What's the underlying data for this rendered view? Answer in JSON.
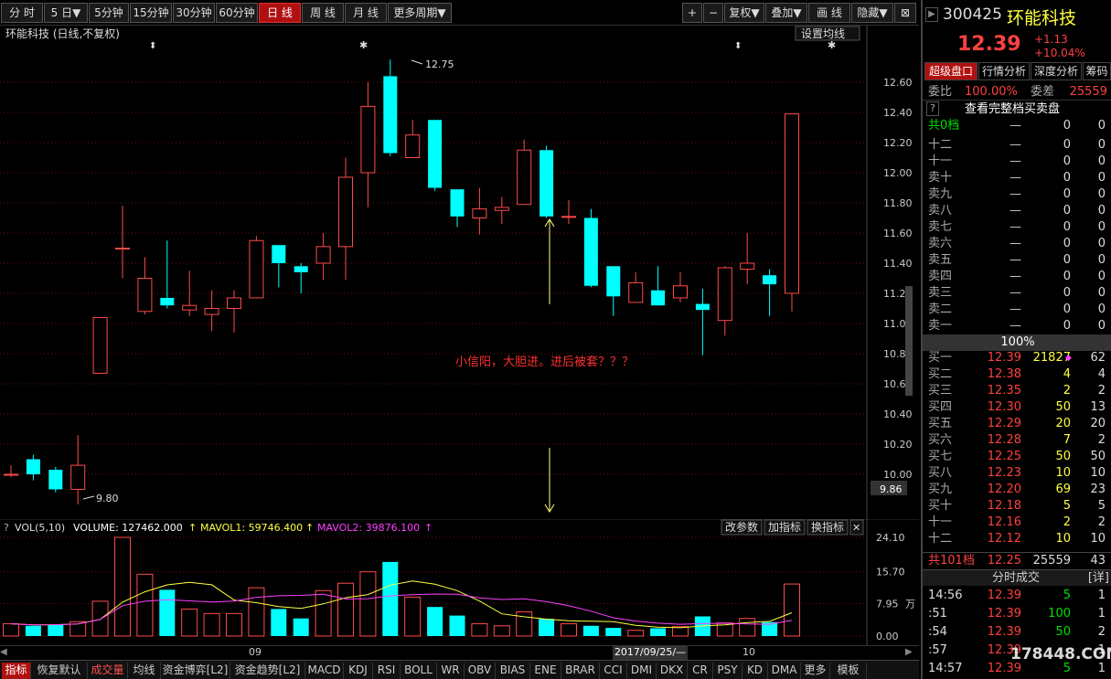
{
  "toolbar": {
    "periods": [
      "分 时",
      "5 日▼",
      "5分钟",
      "15分钟",
      "30分钟",
      "60分钟",
      "日 线",
      "周 线",
      "月 线",
      "更多周期▼"
    ],
    "active_period": "日 线",
    "right_buttons": [
      "+",
      "−",
      "复权▼",
      "叠加▼",
      "画 线",
      "隐藏▼"
    ],
    "close_icon_label": "⊠"
  },
  "chart": {
    "title": "环能科技 (日线,不复权)",
    "ma_settings": "设置均线",
    "annotation_text": "小信阳，大胆进。进后被套？？？",
    "high_label": "12.75",
    "low_label": "9.80",
    "cursor_price": "9.86",
    "y_labels": [
      "12.60",
      "12.40",
      "12.20",
      "12.00",
      "11.80",
      "11.60",
      "11.40",
      "11.20",
      "11.00",
      "10.80",
      "10.60",
      "10.40",
      "10.20",
      "10.00"
    ]
  },
  "volume": {
    "label": "VOL(5,10)",
    "volume_text": "VOLUME: 127462.000",
    "mavol1_text": "MAVOL1: 59746.400",
    "mavol2_text": "MAVOL2: 39876.100",
    "buttons": [
      "改参数",
      "加指标",
      "换指标",
      "✕"
    ],
    "y_labels": [
      "24.10",
      "15.70",
      "7.95",
      "0.00"
    ],
    "unit": "万"
  },
  "axis": {
    "month_09": "09",
    "month_10": "10",
    "cursor_date": "2017/09/25/—"
  },
  "bottom_tabs": [
    "指标",
    "恢复默认",
    "成交量",
    "均线",
    "资金博弈[L2]",
    "资金趋势[L2]",
    "MACD",
    "KDJ",
    "RSI",
    "BOLL",
    "WR",
    "OBV",
    "BIAS",
    "ENE",
    "BRAR",
    "CCI",
    "DMI",
    "DKX",
    "CR",
    "PSY",
    "KD",
    "DMA",
    "更多",
    "模板"
  ],
  "active_bottom_tab": "成交量",
  "stock": {
    "code": "300425",
    "name": "环能科技",
    "price": "12.39",
    "change": "+1.13",
    "change_pct": "+10.04%"
  },
  "right_tabs": [
    "超级盘口",
    "行情分析",
    "深度分析",
    "筹码"
  ],
  "weibi": {
    "label1": "委比",
    "value1": "100.00%",
    "label2": "委差",
    "value2": "25559"
  },
  "full_book_link": "查看完整档买卖盘",
  "sell_total": "共0档",
  "sell_rows": [
    {
      "label": "十二",
      "price": "—",
      "vol": "0",
      "cnt": "0"
    },
    {
      "label": "十一",
      "price": "—",
      "vol": "0",
      "cnt": "0"
    },
    {
      "label": "卖十",
      "price": "—",
      "vol": "0",
      "cnt": "0"
    },
    {
      "label": "卖九",
      "price": "—",
      "vol": "0",
      "cnt": "0"
    },
    {
      "label": "卖八",
      "price": "—",
      "vol": "0",
      "cnt": "0"
    },
    {
      "label": "卖七",
      "price": "—",
      "vol": "0",
      "cnt": "0"
    },
    {
      "label": "卖六",
      "price": "—",
      "vol": "0",
      "cnt": "0"
    },
    {
      "label": "卖五",
      "price": "—",
      "vol": "0",
      "cnt": "0"
    },
    {
      "label": "卖四",
      "price": "—",
      "vol": "0",
      "cnt": "0"
    },
    {
      "label": "卖三",
      "price": "—",
      "vol": "0",
      "cnt": "0"
    },
    {
      "label": "卖二",
      "price": "—",
      "vol": "0",
      "cnt": "0"
    },
    {
      "label": "卖一",
      "price": "—",
      "vol": "0",
      "cnt": "0"
    }
  ],
  "mid_pct": "100%",
  "buy_rows": [
    {
      "label": "买一",
      "price": "12.39",
      "vol": "21827",
      "cnt": "62"
    },
    {
      "label": "买二",
      "price": "12.38",
      "vol": "4",
      "cnt": "4"
    },
    {
      "label": "买三",
      "price": "12.35",
      "vol": "2",
      "cnt": "2"
    },
    {
      "label": "买四",
      "price": "12.30",
      "vol": "50",
      "cnt": "13"
    },
    {
      "label": "买五",
      "price": "12.29",
      "vol": "20",
      "cnt": "20"
    },
    {
      "label": "买六",
      "price": "12.28",
      "vol": "7",
      "cnt": "2"
    },
    {
      "label": "买七",
      "price": "12.25",
      "vol": "50",
      "cnt": "50"
    },
    {
      "label": "买八",
      "price": "12.23",
      "vol": "10",
      "cnt": "10"
    },
    {
      "label": "买九",
      "price": "12.20",
      "vol": "69",
      "cnt": "23"
    },
    {
      "label": "买十",
      "price": "12.18",
      "vol": "5",
      "cnt": "5"
    },
    {
      "label": "十一",
      "price": "12.16",
      "vol": "2",
      "cnt": "2"
    },
    {
      "label": "十二",
      "price": "12.12",
      "vol": "10",
      "cnt": "10"
    }
  ],
  "buy_total": {
    "label": "共101档",
    "price": "12.25",
    "vol": "25559",
    "cnt": "43"
  },
  "trades_header": "分时成交",
  "trades_detail": "[详]",
  "trades": [
    {
      "time": "14:56",
      "price": "12.39",
      "vol": "5",
      "cnt": "1"
    },
    {
      "time": ":51",
      "price": "12.39",
      "vol": "100",
      "cnt": "1"
    },
    {
      "time": ":54",
      "price": "12.39",
      "vol": "50",
      "cnt": "2"
    },
    {
      "time": ":57",
      "price": "12.39",
      "vol": "",
      "cnt": "1"
    },
    {
      "time": "14:57",
      "price": "12.39",
      "vol": "5",
      "cnt": "1"
    }
  ],
  "watermark": "178448.COM",
  "chart_data": {
    "type": "candlestick",
    "title": "环能科技 (日线,不复权)",
    "ylim": [
      9.8,
      12.75
    ],
    "candles": [
      {
        "o": 10.0,
        "h": 10.06,
        "l": 9.98,
        "c": 10.0
      },
      {
        "o": 10.1,
        "h": 10.13,
        "l": 9.96,
        "c": 10.0
      },
      {
        "o": 10.03,
        "h": 10.05,
        "l": 9.88,
        "c": 9.9
      },
      {
        "o": 9.9,
        "h": 10.26,
        "l": 9.8,
        "c": 10.06
      },
      {
        "o": 10.67,
        "h": 11.04,
        "l": 10.67,
        "c": 11.04
      },
      {
        "o": 11.5,
        "h": 11.78,
        "l": 11.3,
        "c": 11.5
      },
      {
        "o": 11.08,
        "h": 11.44,
        "l": 11.06,
        "c": 11.3
      },
      {
        "o": 11.17,
        "h": 11.55,
        "l": 11.1,
        "c": 11.12
      },
      {
        "o": 11.09,
        "h": 11.35,
        "l": 11.05,
        "c": 11.12
      },
      {
        "o": 11.06,
        "h": 11.22,
        "l": 10.95,
        "c": 11.1
      },
      {
        "o": 11.1,
        "h": 11.22,
        "l": 10.94,
        "c": 11.17
      },
      {
        "o": 11.17,
        "h": 11.58,
        "l": 11.17,
        "c": 11.55
      },
      {
        "o": 11.52,
        "h": 11.52,
        "l": 11.24,
        "c": 11.4
      },
      {
        "o": 11.38,
        "h": 11.4,
        "l": 11.2,
        "c": 11.34
      },
      {
        "o": 11.4,
        "h": 11.6,
        "l": 11.29,
        "c": 11.51
      },
      {
        "o": 11.51,
        "h": 12.1,
        "l": 11.29,
        "c": 11.97
      },
      {
        "o": 12.0,
        "h": 12.6,
        "l": 11.77,
        "c": 12.44
      },
      {
        "o": 12.64,
        "h": 12.75,
        "l": 12.11,
        "c": 12.13
      },
      {
        "o": 12.1,
        "h": 12.35,
        "l": 12.1,
        "c": 12.25
      },
      {
        "o": 12.35,
        "h": 12.35,
        "l": 11.88,
        "c": 11.9
      },
      {
        "o": 11.89,
        "h": 11.89,
        "l": 11.64,
        "c": 11.71
      },
      {
        "o": 11.7,
        "h": 11.9,
        "l": 11.59,
        "c": 11.76
      },
      {
        "o": 11.75,
        "h": 11.84,
        "l": 11.66,
        "c": 11.77
      },
      {
        "o": 11.79,
        "h": 12.22,
        "l": 11.79,
        "c": 12.15
      },
      {
        "o": 12.15,
        "h": 12.18,
        "l": 11.7,
        "c": 11.71
      },
      {
        "o": 11.71,
        "h": 11.82,
        "l": 11.66,
        "c": 11.71
      },
      {
        "o": 11.7,
        "h": 11.76,
        "l": 11.24,
        "c": 11.25
      },
      {
        "o": 11.38,
        "h": 11.38,
        "l": 11.05,
        "c": 11.18
      },
      {
        "o": 11.14,
        "h": 11.34,
        "l": 11.14,
        "c": 11.27
      },
      {
        "o": 11.22,
        "h": 11.38,
        "l": 11.12,
        "c": 11.12
      },
      {
        "o": 11.17,
        "h": 11.34,
        "l": 11.14,
        "c": 11.25
      },
      {
        "o": 11.13,
        "h": 11.23,
        "l": 10.79,
        "c": 11.09
      },
      {
        "o": 11.02,
        "h": 11.38,
        "l": 10.92,
        "c": 11.37
      },
      {
        "o": 11.36,
        "h": 11.6,
        "l": 11.26,
        "c": 11.4
      },
      {
        "o": 11.32,
        "h": 11.36,
        "l": 11.05,
        "c": 11.26
      },
      {
        "o": 11.2,
        "h": 11.25,
        "l": 11.08,
        "c": 12.39
      }
    ],
    "volume": [
      3.0,
      2.5,
      2.8,
      3.5,
      8.5,
      24.1,
      15.1,
      11.3,
      6.6,
      5.5,
      5.5,
      11.8,
      6.6,
      4.3,
      11.1,
      12.9,
      15.7,
      18.1,
      9.5,
      7.1,
      5.0,
      3.0,
      2.5,
      5.9,
      4.2,
      3.0,
      2.5,
      2.0,
      1.4,
      1.9,
      2.3,
      4.8,
      3.2,
      4.3,
      3.4,
      12.7
    ],
    "vol_ylim": [
      0,
      24.1
    ]
  }
}
